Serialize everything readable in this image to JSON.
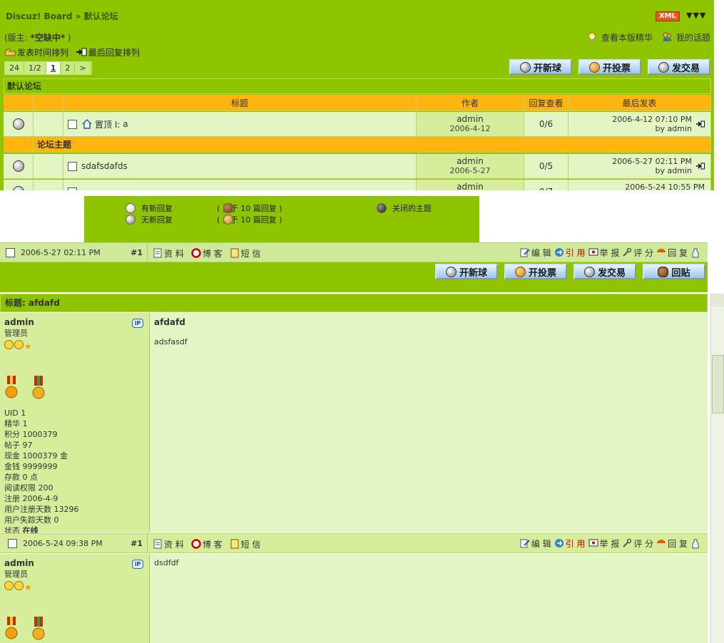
{
  "breadcrumb": "Discuz! Board » 默认论坛",
  "xml_badge": "XML",
  "moderator_label": "(版主: ",
  "moderator_name": "*空缺中*",
  "moderator_close": " )",
  "toplinks": {
    "digest": "查看本版精华",
    "my_topics": "我的话题"
  },
  "sort": {
    "by_post_time": "发表时间排列",
    "by_last_reply": "最后回复排列"
  },
  "pager": {
    "total": "24",
    "page_of": "1/2",
    "pages": [
      "1",
      "2"
    ],
    "next": ">"
  },
  "buttons": {
    "new_topic": "开新球",
    "new_poll": "开投票",
    "new_trade": "发交易",
    "reply": "回贴"
  },
  "forum_name": "默认论坛",
  "table_headers": {
    "title": "标题",
    "author": "作者",
    "replies_views": "回复查看",
    "last_post": "最后发表"
  },
  "section_label": "论坛主题",
  "topics": [
    {
      "prefix": "置顶 I:",
      "title": "a",
      "author": "admin",
      "author_date": "2006-4-12",
      "replies_views": "0/6",
      "last_time": "2006-4-12 07:10 PM",
      "last_by": "by admin"
    },
    {
      "prefix": "",
      "title": "sdafsdafds",
      "author": "admin",
      "author_date": "2006-5-27",
      "replies_views": "0/5",
      "last_time": "2006-5-27 02:11 PM",
      "last_by": "by admin"
    },
    {
      "prefix": "",
      "title": "",
      "author": "admin",
      "author_date": "",
      "replies_views": "0/7",
      "last_time": "2006-5-24 10:55 PM",
      "last_by": ""
    }
  ],
  "legend": {
    "new_reply": "有新回复",
    "no_new_reply": "无新回复",
    "hot_new": "( 多于  10 篇回复 )",
    "hot_no_new": "( 多于  10 篇回复 )",
    "closed": "关闭的主题"
  },
  "post_tools": {
    "profile": "资 料",
    "blog": "博 客",
    "pm": "短 信",
    "edit": "编 辑",
    "quote": "引 用",
    "report": "举 报",
    "rate": "评 分",
    "reply": "回 复"
  },
  "thread_subject": "标题: afdafd",
  "posts": [
    {
      "date": "2006-5-27 02:11 PM",
      "floor": "#1",
      "username": "admin",
      "usergroup": "管理员",
      "title": "afdafd",
      "body": "adsfasdf",
      "stats": [
        "UID 1",
        "精华 1",
        "积分  1000379",
        "帖子  97",
        "现金  1000379 金",
        "金钱  9999999",
        "存款  0 点",
        "阅读权限  200",
        "注册  2006-4-9",
        "用户注册天数  13296",
        "用户失踪天数  0"
      ],
      "status_label": "状态 ",
      "status_value": "在线"
    },
    {
      "date": "2006-5-24 09:38 PM",
      "floor": "#1",
      "username": "admin",
      "usergroup": "管理员",
      "title": "",
      "body": "dsdfdf"
    }
  ],
  "ip_badge": "iP"
}
